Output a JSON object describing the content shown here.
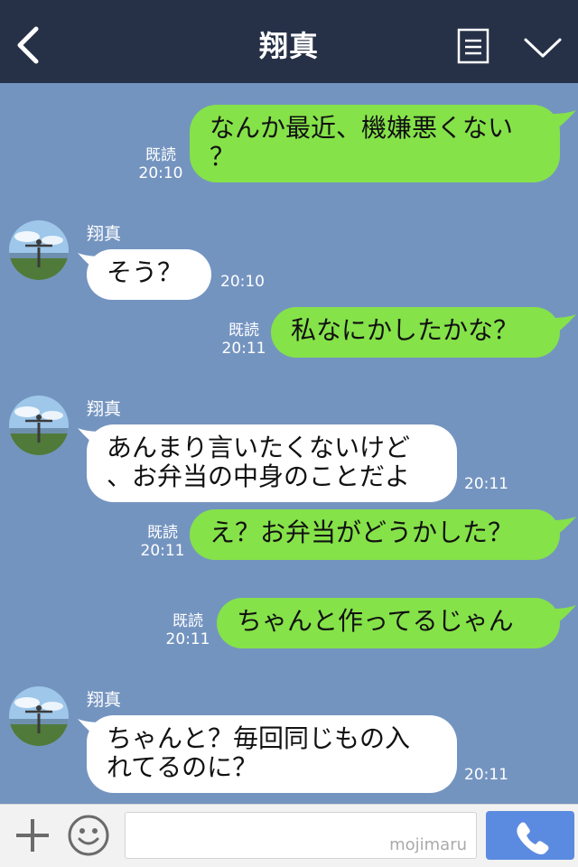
{
  "header": {
    "title": "翔真",
    "back_icon": "chevron-left-icon",
    "menu_icon": "document-menu-icon",
    "collapse_icon": "chevron-down-icon",
    "background": "#263148"
  },
  "chat": {
    "background": "#7494c0",
    "sent_bubble_color": "#85e249",
    "received_bubble_color": "#ffffff",
    "read_label": "既読",
    "messages": [
      {
        "from": "me",
        "text": "なんか最近、機嫌悪くない\n？",
        "read": "既読",
        "time": "20:10"
      },
      {
        "from": "翔真",
        "sender_name": "翔真",
        "text": "そう？",
        "time": "20:10"
      },
      {
        "from": "me",
        "text": "私なにかしたかな？",
        "read": "既読",
        "time": "20:11"
      },
      {
        "from": "翔真",
        "sender_name": "翔真",
        "text": "あんまり言いたくないけど\n、お弁当の中身のことだよ",
        "time": "20:11"
      },
      {
        "from": "me",
        "text": "え？お弁当がどうかした？",
        "read": "既読",
        "time": "20:11"
      },
      {
        "from": "me",
        "text": "ちゃんと作ってるじゃん",
        "read": "既読",
        "time": "20:11"
      },
      {
        "from": "翔真",
        "sender_name": "翔真",
        "text": "ちゃんと？毎回同じもの入\nれてるのに？",
        "time": "20:11"
      }
    ]
  },
  "footer": {
    "plus_icon": "plus-icon",
    "emoji_icon": "smiley-icon",
    "input_value": "",
    "watermark": "mojimaru",
    "call_icon": "phone-icon",
    "call_color": "#5b8be0"
  }
}
